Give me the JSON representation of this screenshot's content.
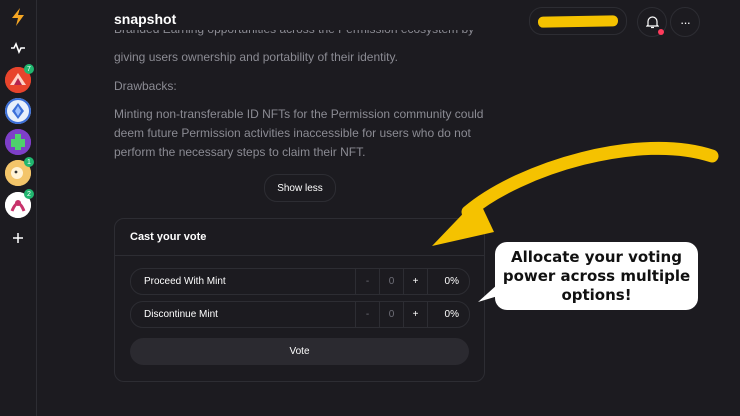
{
  "app": {
    "title": "snapshot"
  },
  "sidebar": {
    "logo_icon": "lightning-icon",
    "activity_icon": "activity-icon",
    "spaces": [
      {
        "name": "space-1",
        "badge": "7",
        "color": "#e8442c"
      },
      {
        "name": "space-2",
        "badge": "",
        "color": "#3b6fd8"
      },
      {
        "name": "space-3",
        "badge": "",
        "color": "#7e3fc8"
      },
      {
        "name": "space-4",
        "badge": "1",
        "color": "#f3c56a"
      },
      {
        "name": "space-5",
        "badge": "2",
        "color": "#c8326b"
      }
    ],
    "add_icon": "plus-icon"
  },
  "header": {
    "bell_icon": "bell-icon",
    "more_icon": "ellipsis-icon",
    "more_label": "···"
  },
  "proposal": {
    "partial_line": "Branded Earning opportunities across the Permission ecosystem by",
    "line2": "giving users ownership and portability of their identity.",
    "drawbacks_heading": "Drawbacks:",
    "drawbacks_text": "Minting non-transferable ID NFTs for the Permission community could deem future Permission activities inaccessible for users who do not perform the necessary steps to claim their NFT.",
    "show_less_label": "Show less"
  },
  "vote": {
    "title": "Cast your vote",
    "choices": [
      {
        "label": "Proceed With Mint",
        "minus": "-",
        "value": "0",
        "plus": "+",
        "percent": "0%"
      },
      {
        "label": "Discontinue Mint",
        "minus": "-",
        "value": "0",
        "plus": "+",
        "percent": "0%"
      }
    ],
    "vote_button": "Vote"
  },
  "callout": {
    "text": "Allocate your voting power across multiple options!",
    "arrow_color": "#f5c200"
  }
}
